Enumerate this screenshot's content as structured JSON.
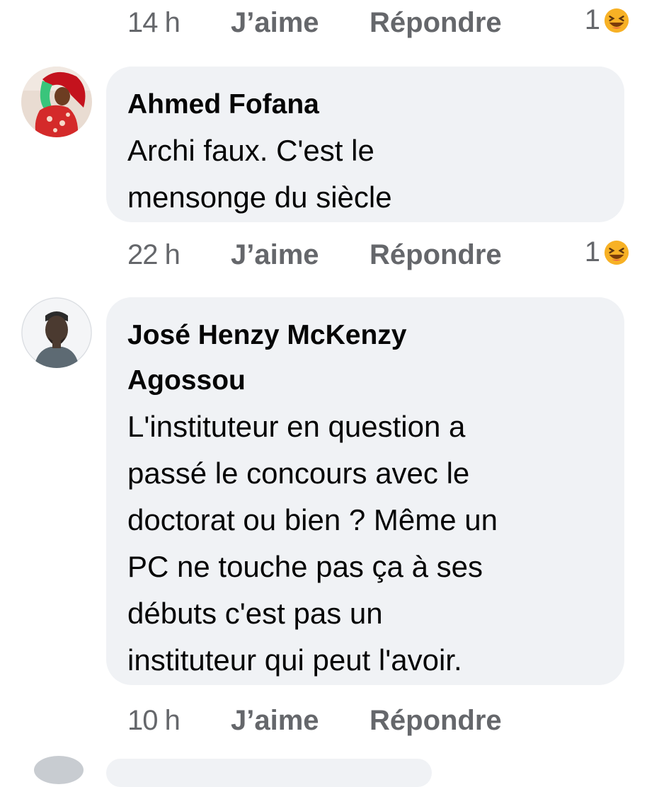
{
  "reaction_colors": {
    "emoji_face": "#f7b125",
    "emoji_mouth": "#7a3b0a"
  },
  "top_actions": {
    "time": "14 h",
    "like": "J’aime",
    "reply": "Répondre",
    "reaction_count": "1"
  },
  "comments": [
    {
      "author": "Ahmed Fofana",
      "text_lines": [
        "Archi faux. C'est le",
        "mensonge du siècle"
      ],
      "actions": {
        "time": "22 h",
        "like": "J’aime",
        "reply": "Répondre",
        "reaction_count": "1"
      }
    },
    {
      "author_lines": [
        "José Henzy McKenzy",
        "Agossou"
      ],
      "text_lines": [
        "L'instituteur en question a",
        "passé le concours avec le",
        "doctorat ou bien ? Même un",
        "PC ne touche pas ça à ses",
        "débuts c'est pas un",
        "instituteur qui peut l'avoir."
      ],
      "actions": {
        "time": "10 h",
        "like": "J’aime",
        "reply": "Répondre"
      }
    }
  ]
}
